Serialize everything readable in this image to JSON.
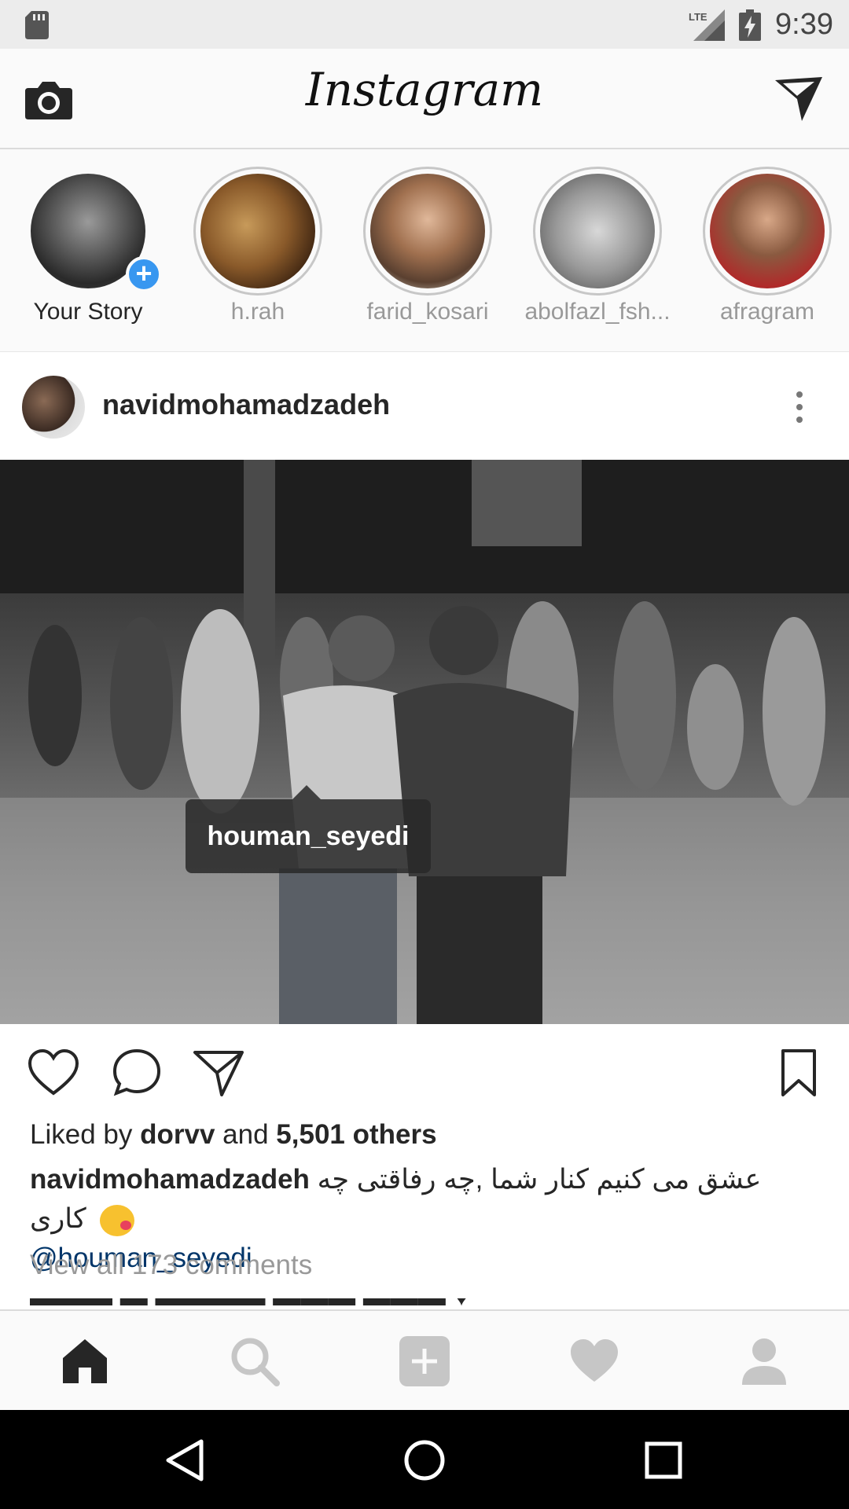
{
  "status_bar": {
    "time": "9:39",
    "network": "LTE",
    "icons": [
      "sd-card-icon",
      "lte-signal-icon",
      "battery-charging-icon"
    ]
  },
  "app_bar": {
    "brand": "Instagram",
    "left_icon": "camera-icon",
    "right_icon": "direct-send-icon"
  },
  "stories": [
    {
      "label": "Your Story",
      "is_own": true
    },
    {
      "label": "h.rah"
    },
    {
      "label": "farid_kosari"
    },
    {
      "label": "abolfazl_fsh..."
    },
    {
      "label": "afragram"
    }
  ],
  "post": {
    "username": "navidmohamadzadeh",
    "photo_tag": "houman_seyedi",
    "likes": {
      "prefix": "Liked by",
      "user": "dorvv",
      "joiner": "and",
      "others": "5,501 others"
    },
    "caption": {
      "username": "navidmohamadzadeh",
      "text": "عشق می کنیم کنار شما ,چه رفاقتی چه کاری",
      "mention": "@houman_seyedi"
    },
    "view_comments": "View all 173 comments"
  },
  "bottom_nav": {
    "items": [
      "home-icon",
      "search-icon",
      "add-post-icon",
      "activity-heart-icon",
      "profile-icon"
    ],
    "active": "home-icon"
  },
  "colors": {
    "link": "#003569",
    "accent_blue": "#3897f0",
    "muted": "#999999"
  }
}
